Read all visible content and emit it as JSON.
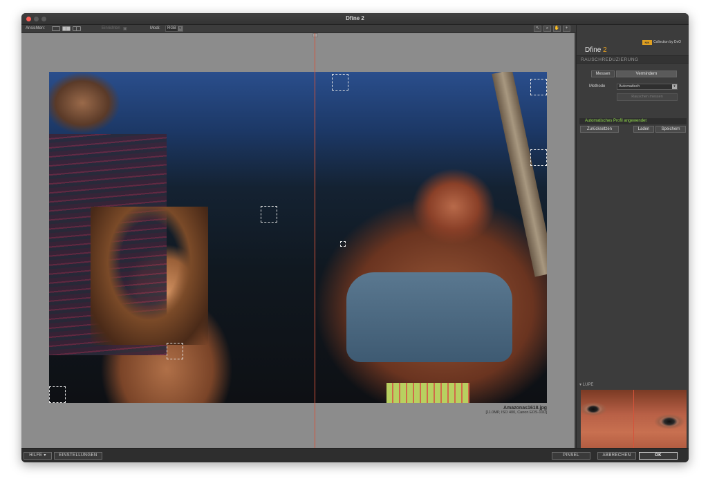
{
  "window": {
    "title": "Dfine 2"
  },
  "toolbar": {
    "views_label": "Ansichten:",
    "preview_label": "Einrichten",
    "mode_label": "Modi:",
    "mode_value": "RGB"
  },
  "canvas": {
    "filename": "Amazonas1618.jpg",
    "file_meta": "[11.0MP, ISO 400, Canon EOS-10D]"
  },
  "panel": {
    "collection_badge": "NIK",
    "collection_text": "Collection by DxO",
    "brand_name": "Dfine",
    "brand_version": "2",
    "section_title": "RAUSCHREDUZIERUNG",
    "tab_measure": "Messen",
    "tab_reduce": "Vermindern",
    "method_label": "Methode",
    "method_value": "Automatisch",
    "measure_button": "Rauschen messen",
    "profile_status": "Automatisches Profil angewendet",
    "reset_button": "Zurücksetzen",
    "load_button": "Laden",
    "save_button": "Speichern",
    "loupe_label": "LUPE",
    "pin_label": "⇑"
  },
  "bottom": {
    "help_button": "HILFE ▾",
    "settings_button": "EINSTELLUNGEN",
    "brush_button": "PINSEL",
    "cancel_button": "ABBRECHEN",
    "ok_button": "OK"
  },
  "colors": {
    "accent": "#f0a620",
    "status_green": "#8fd84a",
    "split_line": "#d4533a",
    "close_button": "#fe5f57"
  }
}
